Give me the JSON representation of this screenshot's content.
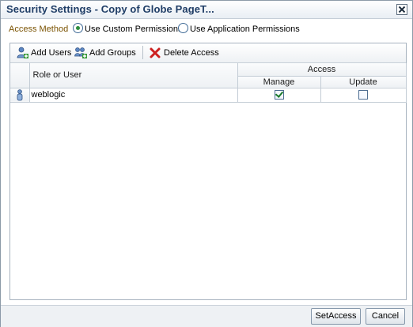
{
  "dialog": {
    "title": "Security Settings - Copy of Globe PageT...",
    "close_icon": "close-x-icon"
  },
  "access_method": {
    "label": "Access Method",
    "options": [
      {
        "label": "Use Custom Permissions",
        "selected": true
      },
      {
        "label": "Use Application Permissions",
        "selected": false
      }
    ]
  },
  "toolbar": {
    "add_users": "Add Users",
    "add_groups": "Add Groups",
    "delete_access": "Delete Access"
  },
  "table": {
    "col_role": "Role or User",
    "group_access": "Access",
    "col_manage": "Manage",
    "col_update": "Update",
    "rows": [
      {
        "icon": "user-icon",
        "name": "weblogic",
        "manage": true,
        "update": false
      }
    ]
  },
  "footer": {
    "set_access": "SetAccess",
    "cancel": "Cancel"
  },
  "colors": {
    "title_text": "#1f3d66",
    "access_label": "#7a5200",
    "check_green": "#1a7a2a",
    "delete_red": "#cc1f1f"
  }
}
